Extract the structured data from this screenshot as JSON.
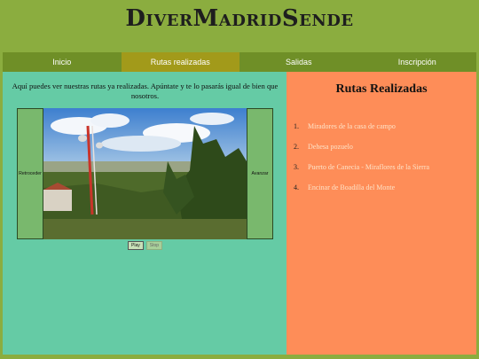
{
  "site": {
    "title": "DiverMadridSende"
  },
  "nav": {
    "items": [
      {
        "label": "Inicio"
      },
      {
        "label": "Rutas realizadas"
      },
      {
        "label": "Salidas"
      },
      {
        "label": "Inscripción"
      }
    ],
    "active_index": 1
  },
  "intro": {
    "text": "Aquí puedes ver nuestras rutas ya realizadas. Apúntate y te lo pasarás igual de bien que nosotros."
  },
  "slider": {
    "prev_label": "Retroceder",
    "next_label": "Avanzar",
    "play_label": "Play",
    "stop_label": "Stop"
  },
  "routes": {
    "title": "Rutas Realizadas",
    "items": [
      {
        "num": "1.",
        "label": "Miradores de la casa de campo"
      },
      {
        "num": "2.",
        "label": "Dehesa pozuelo"
      },
      {
        "num": "3.",
        "label": "Puerto de Canecia - Miraflores de la Sierra"
      },
      {
        "num": "4.",
        "label": "Encinar de Boadilla del Monte"
      }
    ]
  },
  "colors": {
    "page_bg": "#8bad3f",
    "nav_bg": "#6f8f27",
    "nav_active": "#a29a1a",
    "left_panel": "#65cba5",
    "right_panel": "#fe8d58"
  }
}
